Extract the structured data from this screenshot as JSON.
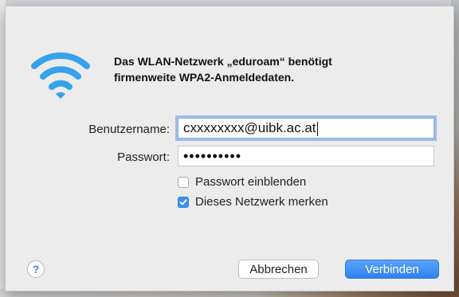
{
  "dialog": {
    "message_line1": "Das WLAN-Netzwerk „eduroam“ benötigt",
    "message_line2": "firmenweite WPA2-Anmeldedaten."
  },
  "form": {
    "username_label": "Benutzername:",
    "username_value": "cxxxxxxxx@uibk.ac.at",
    "password_label": "Passwort:",
    "password_value": "••••••••••",
    "show_password_label": "Passwort einblenden",
    "show_password_checked": false,
    "remember_label": "Dieses Netzwerk merken",
    "remember_checked": true
  },
  "buttons": {
    "help": "?",
    "cancel": "Abbrechen",
    "connect": "Verbinden"
  },
  "icons": {
    "wifi": "wifi-icon",
    "help": "help-icon",
    "check": "checkmark-icon"
  },
  "colors": {
    "accent": "#3d8ff5",
    "wifi": "#35a2ec"
  }
}
